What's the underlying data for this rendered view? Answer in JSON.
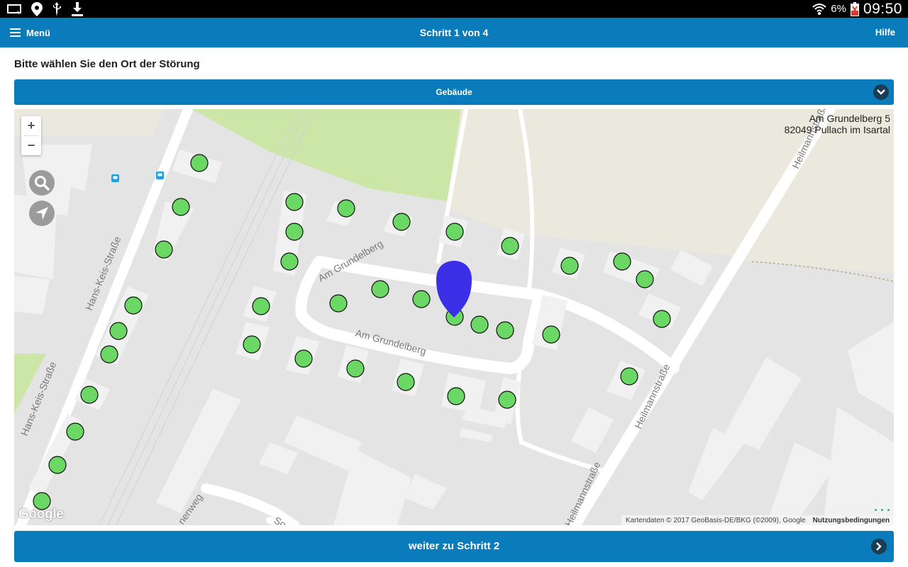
{
  "status_bar": {
    "battery_percent": "6%",
    "time": "09:50"
  },
  "header": {
    "menu_label": "Menü",
    "title": "Schritt 1 von 4",
    "help_label": "Hilfe"
  },
  "prompt": "Bitte wählen Sie den Ort der Störung",
  "location_select": {
    "selected": "Gebäude"
  },
  "map": {
    "address_line1": "Am Grundelberg 5",
    "address_line2": "82049 Pullach im Isartal",
    "zoom_in": "+",
    "zoom_out": "−",
    "street_labels": {
      "hans_keis_1": "Hans-Keis-Straße",
      "hans_keis_2": "Hans-Keis-Straße",
      "grundelberg_1": "Am Grundelberg",
      "grundelberg_2": "Am Grundelberg",
      "heilmann_1": "Heilmannstraße",
      "heilmann_2": "Heilmannstraße",
      "heilmann_3": "Heilmannstraße",
      "tannenweg": "nenweg",
      "south_fragment": "So"
    },
    "google_logo": "Google",
    "attribution": "Kartendaten © 2017 GeoBasis-DE/BKG (©2009), Google",
    "terms": "Nutzungsbedingungen",
    "colors": {
      "marker_green": "#6bd764",
      "pin_blue": "#3a2fe6",
      "park_green": "#cbe6a6"
    }
  },
  "next_button": {
    "label": "weiter zu Schritt 2"
  }
}
